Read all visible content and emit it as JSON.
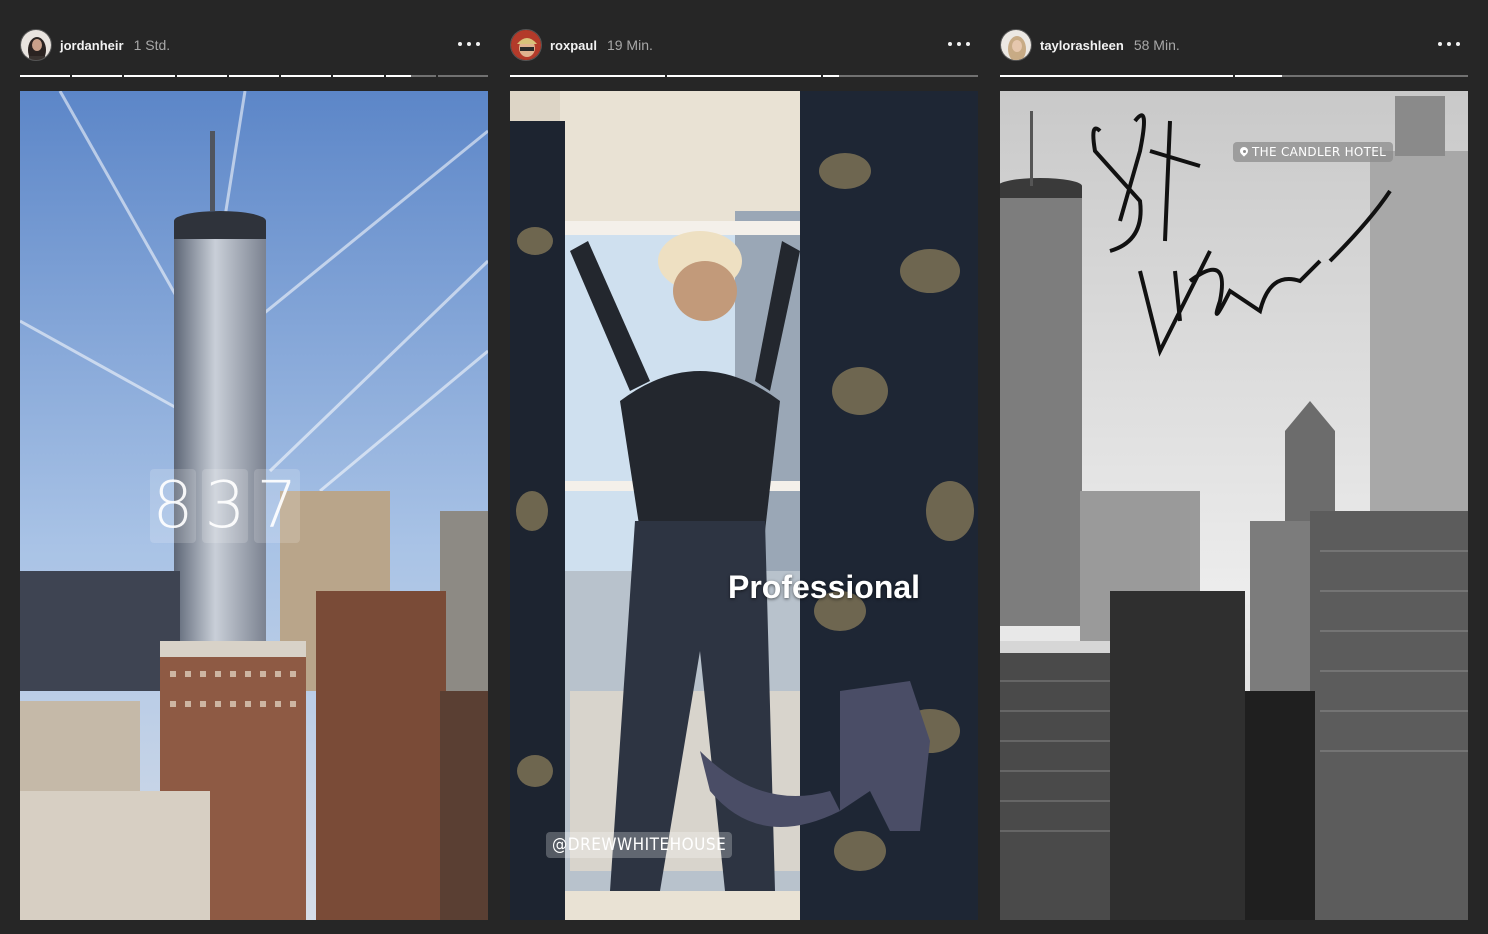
{
  "stories": [
    {
      "username": "jordanheir",
      "time": "1 Std.",
      "progress_segments": [
        1,
        1,
        1,
        1,
        1,
        1,
        1,
        0.5,
        0
      ],
      "sticker_clock": [
        "8",
        "3",
        "7"
      ]
    },
    {
      "username": "roxpaul",
      "time": "19 Min.",
      "progress_segments": [
        1,
        1,
        0.1
      ],
      "caption": "Professional",
      "mention": "@DREWWHITEHOUSE"
    },
    {
      "username": "taylorashleen",
      "time": "58 Min.",
      "progress_segments": [
        1,
        0.2
      ],
      "handwriting": "Sat Views",
      "location": "THE CANDLER HOTEL"
    }
  ],
  "icons": {
    "more": "more-horizontal-icon",
    "location": "location-pin-icon"
  }
}
